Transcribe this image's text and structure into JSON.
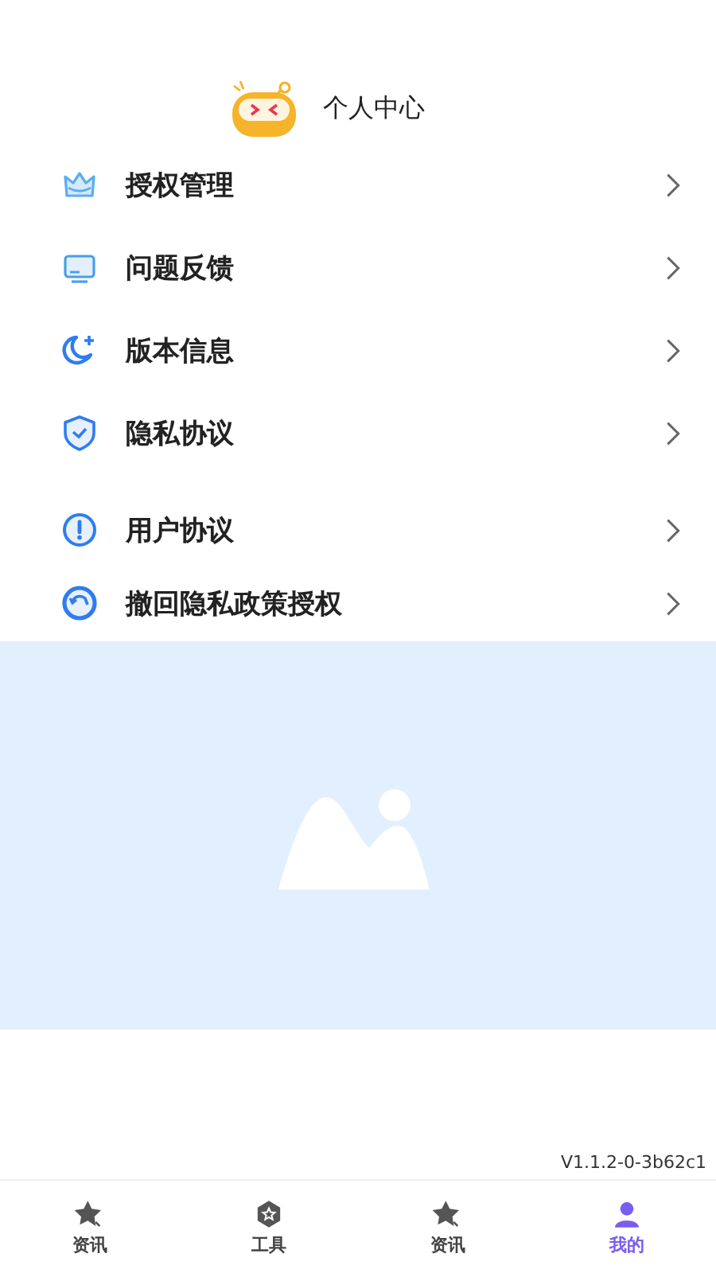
{
  "header": {
    "title": "个人中心"
  },
  "menu_groups": [
    {
      "items": [
        {
          "label": "授权管理"
        },
        {
          "label": "问题反馈"
        },
        {
          "label": "版本信息"
        },
        {
          "label": "隐私协议"
        }
      ]
    },
    {
      "items": [
        {
          "label": "用户协议"
        },
        {
          "label": "撤回隐私政策授权"
        }
      ]
    }
  ],
  "version": "V1.1.2-0-3b62c1",
  "tabs": [
    {
      "label": "资讯",
      "selected": false
    },
    {
      "label": "工具",
      "selected": false
    },
    {
      "label": "资讯",
      "selected": false
    },
    {
      "label": "我的",
      "selected": true
    }
  ]
}
